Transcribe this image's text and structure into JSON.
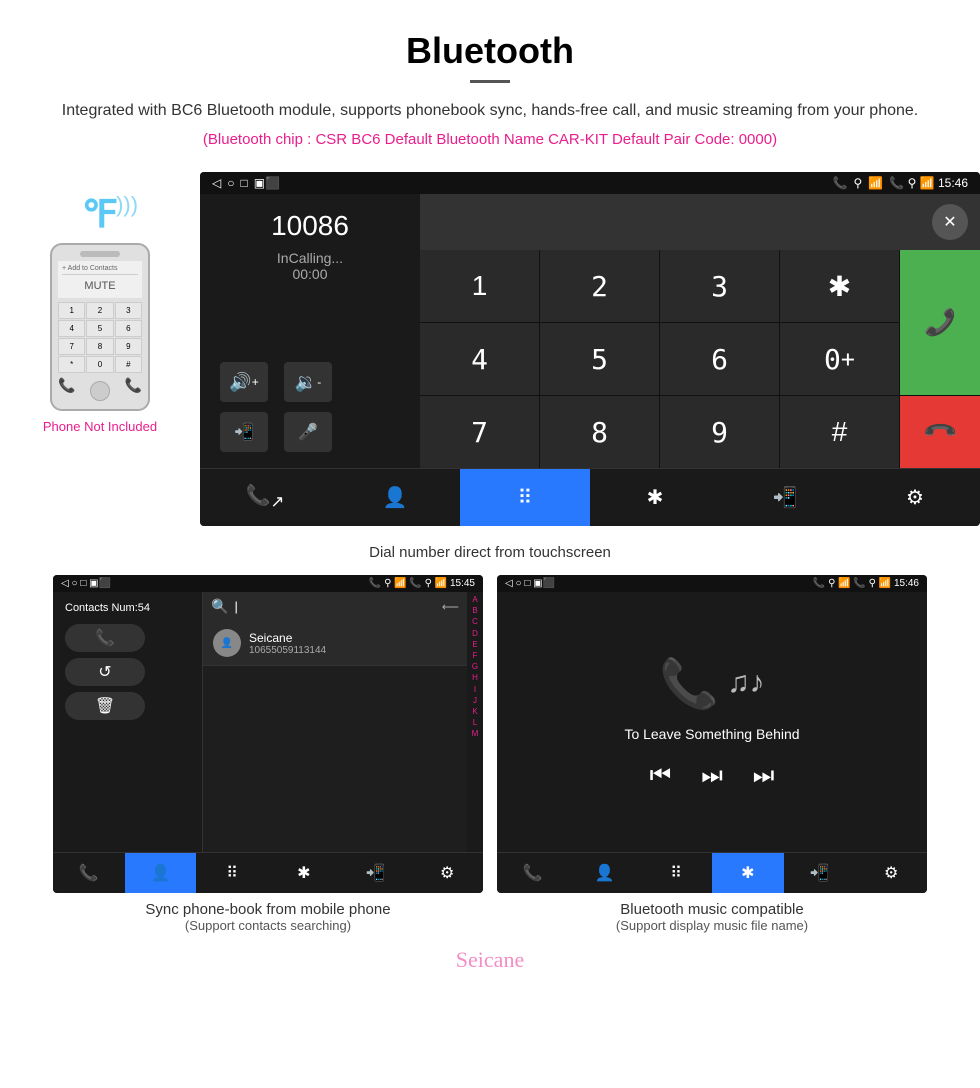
{
  "page": {
    "title": "Bluetooth",
    "divider": true,
    "description": "Integrated with BC6 Bluetooth module, supports phonebook sync, hands-free call, and music streaming from your phone.",
    "specs": "(Bluetooth chip : CSR BC6    Default Bluetooth Name CAR-KIT    Default Pair Code: 0000)"
  },
  "main_screen": {
    "status_bar": {
      "left": "◁  ○  □  ▣ ⬛",
      "right": "📞 ⚲ 📶 15:46"
    },
    "dial_number": "10086",
    "calling_label": "InCalling...",
    "calling_time": "00:00",
    "volume_up": "🔊+",
    "volume_down": "🔉-",
    "transfer_icon": "📲",
    "mic_icon": "🎤",
    "numpad": [
      "1",
      "2",
      "3",
      "*",
      "4",
      "5",
      "6",
      "0+",
      "7",
      "8",
      "9",
      "#"
    ],
    "call_btn": "📞",
    "end_btn": "📞",
    "bottom_buttons": [
      "📞↗",
      "👤",
      "⠿",
      "*⃣",
      "📲",
      "⚙"
    ]
  },
  "caption_main": "Dial number direct from touchscreen",
  "contacts_screen": {
    "status_bar": {
      "left": "◁  ○  □  ▣ ⬛",
      "right": "📞 ⚲ 📶 15:45"
    },
    "contacts_num": "Contacts Num:54",
    "actions": [
      "📞",
      "↺",
      "🗑"
    ],
    "search_placeholder": "",
    "contact_name": "Seicane",
    "contact_number": "10655059113144",
    "alphabet": [
      "A",
      "B",
      "C",
      "D",
      "E",
      "F",
      "G",
      "H",
      "I",
      "J",
      "K",
      "L",
      "M"
    ],
    "bottom_buttons": [
      "📞↗",
      "👤",
      "⠿",
      "*⃣",
      "📲",
      "⚙"
    ]
  },
  "music_screen": {
    "status_bar": {
      "left": "◁  ○  □  ▣ ⬛",
      "right": "📞 ⚲ 📶 15:46"
    },
    "song_title": "To Leave Something Behind",
    "controls": [
      "⏮",
      "⏭",
      "⏭"
    ],
    "bottom_buttons": [
      "📞↗",
      "👤",
      "⠿",
      "*⃣",
      "📲",
      "⚙"
    ]
  },
  "caption_contacts": {
    "main": "Sync phone-book from mobile phone",
    "sub": "(Support contacts searching)"
  },
  "caption_music": {
    "main": "Bluetooth music compatible",
    "sub": "(Support display music file name)"
  },
  "phone_label": "Phone Not Included",
  "watermark": "Seicane"
}
